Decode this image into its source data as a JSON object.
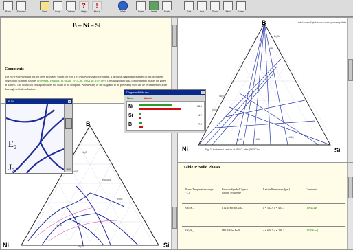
{
  "toolbar": {
    "buttons": [
      {
        "label": "Back",
        "icon": "back-icon"
      },
      {
        "label": "Forward",
        "icon": "forward-icon"
      },
      {
        "label": "Print",
        "icon": "print-icon"
      },
      {
        "label": "Copy",
        "icon": "copy-icon"
      },
      {
        "label": "Options",
        "icon": "options-icon"
      },
      {
        "label": "Help",
        "icon": "help-icon"
      },
      {
        "label": "About",
        "icon": "info-icon"
      },
      {
        "label": "Web",
        "icon": "globe-icon"
      },
      {
        "label": "Zoom",
        "icon": "zoom-icon"
      },
      {
        "label": "Label",
        "icon": "label-icon"
      },
      {
        "label": "Mark",
        "icon": "mark-icon"
      },
      {
        "label": "Edit",
        "icon": "edit-icon"
      },
      {
        "label": "Axis",
        "icon": "axis-icon"
      },
      {
        "label": "Tools",
        "icon": "tools-icon"
      },
      {
        "label": "Find",
        "icon": "find-icon"
      },
      {
        "label": "View",
        "icon": "view-icon"
      }
    ]
  },
  "document": {
    "title": "B – Ni – Si",
    "comments_heading": "Comments",
    "body_parts": [
      {
        "text": "The B-Ni-Si system has not yet been evaluated within the MSIT® Ternary Evaluation Program. The phase diagrams presented in this document origin from different sources ",
        "ref": false
      },
      {
        "text": "[1999Mas, 1964Bur, 1970Kaw, 1975Chu, 1992Lug, 1997Lev]",
        "ref": true
      },
      {
        "text": ". Crystallographic data for the ternary phases are given in Table 1. The collection of diagrams does not claim to be complete. Whether any of the diagrams to be preferably used can be recommended after thorough critical evaluation.",
        "ref": false
      }
    ]
  },
  "diagram_top": {
    "vertex_top": "B",
    "vertex_left": "Ni",
    "vertex_right": "Si",
    "note": "solid curves & pink tracer curves; phase equilibria",
    "caption": "Fig. 2: Isothermal section at 850°C, after [1975Chu]",
    "phase_labels": [
      "NiB",
      "Ni₂B",
      "Ni₃B",
      "B₂Si",
      "NiSi₂",
      "Ni₂Si",
      "NiSi"
    ]
  },
  "diagram_bottom": {
    "vertex_top": "B",
    "vertex_left": "Ni",
    "vertex_right": "Si",
    "phase_labels": [
      "Ni₂B",
      "Ni₃B",
      "Ni₆Si₂B",
      "NiSi",
      "Ni₂Si"
    ],
    "bottom_label": "Ni₃Si"
  },
  "zoom_window": {
    "title": "B-Ni",
    "labels": [
      "E₂",
      "J₂"
    ],
    "scroll_value": "16.0"
  },
  "bar_dialog": {
    "title": "Diagram Attributes",
    "header_left": "Name",
    "header_right": "Mass%",
    "rows": [
      {
        "element": "Ni",
        "value": "88.1",
        "fraction": 0.88
      },
      {
        "element": "Si",
        "value": "4.7",
        "fraction": 0.05
      },
      {
        "element": "B",
        "value": "7.2",
        "fraction": 0.07
      }
    ],
    "bar_colors": {
      "red": "#d01010",
      "green": "#2e9a2e"
    }
  },
  "table": {
    "title": "Table 1: Solid Phases",
    "headers": [
      "Phase/ Temperature range [°C]",
      "Pearson Symbol/ Space Group/ Prototype",
      "Lattice Parameters [pm]",
      "Comments"
    ],
    "rows": [
      {
        "phase": "BNi₂Si₂",
        "pearson": "tI12 I4/mcm CuAl₂",
        "lattice": "a = 562.9  c = 465.3",
        "comment": "[1992Lug]"
      },
      {
        "phase": "BNi₄Si₂",
        "pearson": "hP9 P-62m Fe₂P",
        "lattice": "a = 600.5  c = 289.3",
        "comment": "[1970Kaw]"
      }
    ]
  }
}
